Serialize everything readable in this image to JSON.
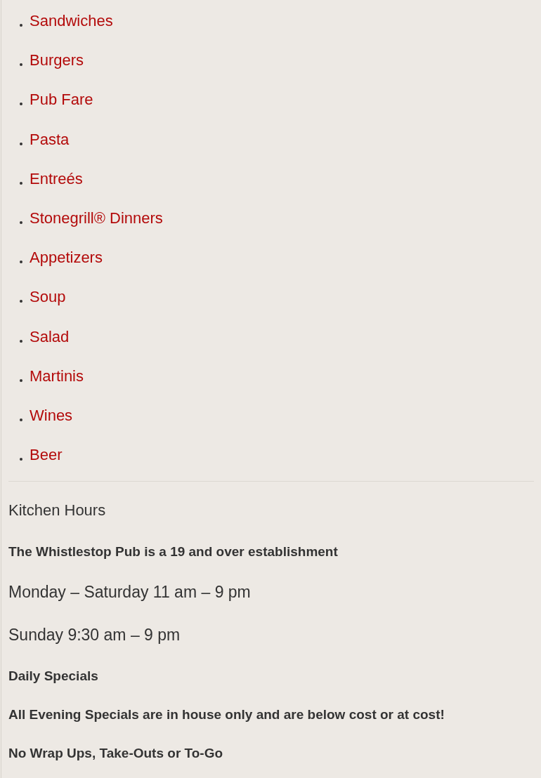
{
  "menu_links": [
    "Sandwiches",
    "Burgers",
    "Pub Fare",
    "Pasta",
    "Entreés",
    "Stonegrill® Dinners",
    "Appetizers",
    "Soup",
    "Salad",
    "Martinis",
    "Wines",
    "Beer"
  ],
  "kitchen_hours": {
    "heading": "Kitchen Hours",
    "notice": "The Whistlestop Pub is a 19 and over establishment",
    "hours": [
      "Monday – Saturday 11 am – 9 pm",
      "Sunday 9:30 am – 9 pm"
    ]
  },
  "daily_specials": {
    "heading": "Daily Specials",
    "notes": [
      "All Evening Specials are in house only and are below cost or at cost!",
      "No Wrap Ups, Take-Outs or To-Go"
    ]
  }
}
